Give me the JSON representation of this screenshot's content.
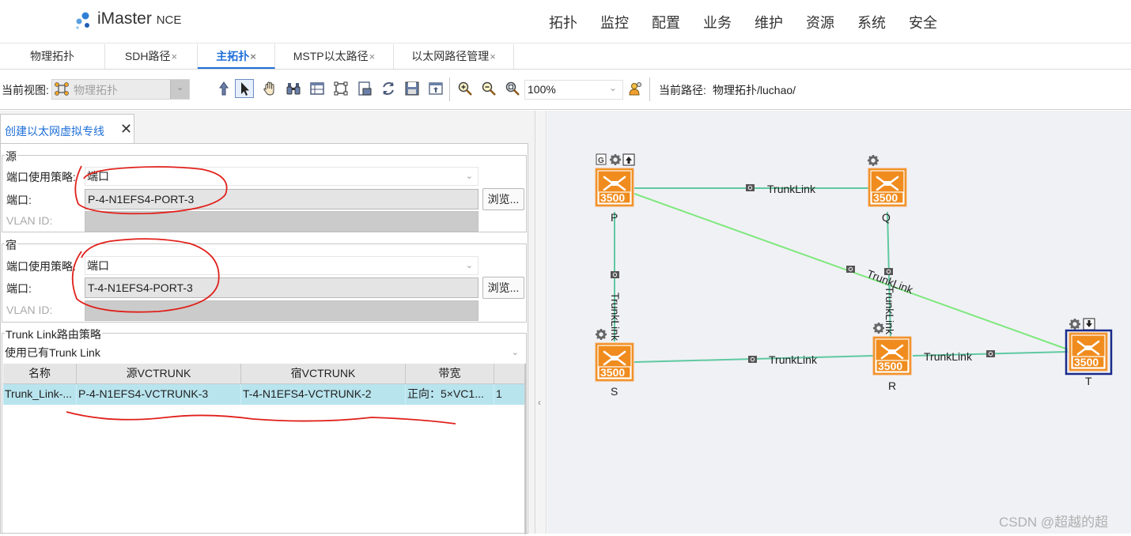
{
  "app": {
    "brand_main": "iMaster",
    "brand_sub": "NCE",
    "menu": [
      "拓扑",
      "监控",
      "配置",
      "业务",
      "维护",
      "资源",
      "系统",
      "安全"
    ]
  },
  "tabs": [
    {
      "label": "物理拓扑",
      "close": ""
    },
    {
      "label": "SDH路径",
      "close": "×"
    },
    {
      "label": "主拓扑",
      "close": "×",
      "active": true
    },
    {
      "label": "MSTP以太路径",
      "close": "×"
    },
    {
      "label": "以太网路径管理",
      "close": "×"
    }
  ],
  "toolbar": {
    "current_view_label": "当前视图:",
    "current_view_value": "物理拓扑",
    "zoom_value": "100%",
    "current_path_label": "当前路径:",
    "current_path_value": "物理拓扑/luchao/"
  },
  "pane": {
    "tab_title": "创建以太网虚拟专线",
    "close": "✕",
    "source": {
      "title": "源",
      "policy_label": "端口使用策略:",
      "policy_value": "端口",
      "port_label": "端口:",
      "port_value": "P-4-N1EFS4-PORT-3",
      "browse_label": "浏览...",
      "vlan_label": "VLAN ID:"
    },
    "sink": {
      "title": "宿",
      "policy_label": "端口使用策略:",
      "policy_value": "端口",
      "port_label": "端口:",
      "port_value": "T-4-N1EFS4-PORT-3",
      "browse_label": "浏览...",
      "vlan_label": "VLAN ID:"
    },
    "trunk": {
      "title": "Trunk Link路由策略",
      "strategy_value": "使用已有Trunk Link",
      "columns": [
        "名称",
        "源VCTRUNK",
        "宿VCTRUNK",
        "带宽",
        ""
      ],
      "rows": [
        [
          "Trunk_Link-...",
          "P-4-N1EFS4-VCTRUNK-3",
          "T-4-N1EFS4-VCTRUNK-2",
          "正向：5×VC1...",
          "1"
        ]
      ]
    }
  },
  "topology": {
    "device_model": "3500",
    "nodes": [
      {
        "id": "P",
        "label": "P"
      },
      {
        "id": "Q",
        "label": "Q"
      },
      {
        "id": "S",
        "label": "S"
      },
      {
        "id": "R",
        "label": "R"
      },
      {
        "id": "T",
        "label": "T"
      }
    ],
    "links": [
      {
        "from": "P",
        "to": "Q",
        "label": "TrunkLink"
      },
      {
        "from": "P",
        "to": "T",
        "label": "TrunkLink"
      },
      {
        "from": "P",
        "to": "S",
        "label": "TrunkLink"
      },
      {
        "from": "Q",
        "to": "R",
        "label": "TrunkLink"
      },
      {
        "from": "S",
        "to": "R",
        "label": "TrunkLink"
      },
      {
        "from": "R",
        "to": "T",
        "label": "TrunkLink"
      }
    ],
    "badges": {
      "g": "G"
    }
  },
  "watermark": "CSDN @超越的超",
  "colors": {
    "accent": "#1e6fd9",
    "device_orange": "#f08c1e",
    "link_green": "#5fc9a0",
    "link_light_green": "#7ee87e",
    "selection_row": "#b8e4ee",
    "annotation_red": "#e0201a"
  }
}
